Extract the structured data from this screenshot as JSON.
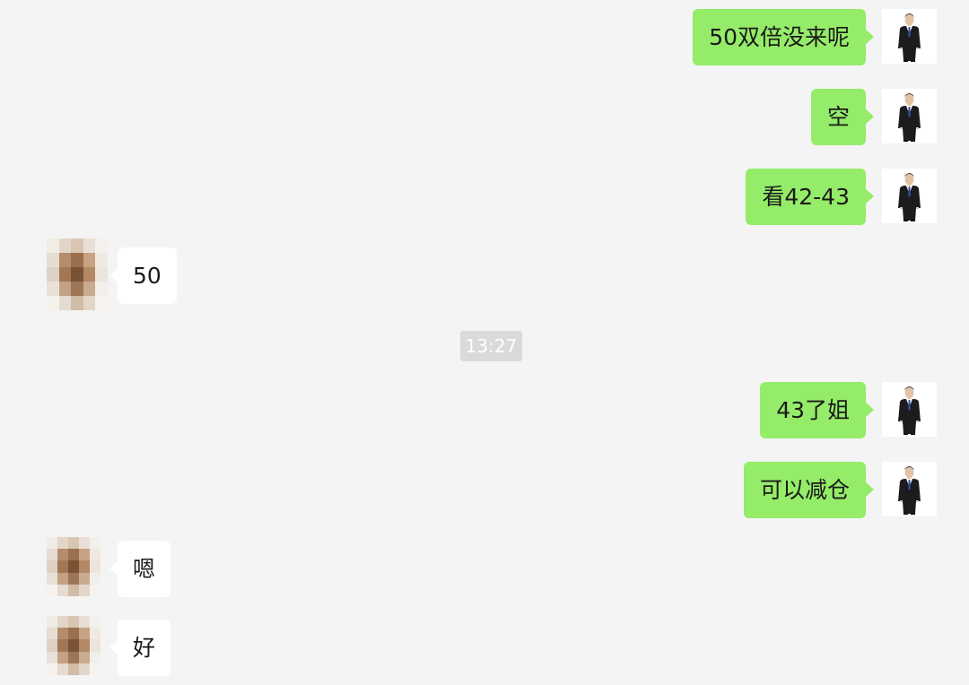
{
  "chat": {
    "messages": [
      {
        "side": "out",
        "text": "50双倍没来呢",
        "avatar": "businessman-avatar"
      },
      {
        "side": "out",
        "text": "空",
        "avatar": "businessman-avatar"
      },
      {
        "side": "out",
        "text": "看42-43",
        "avatar": "businessman-avatar"
      },
      {
        "side": "in",
        "text": "50",
        "avatar": "pixelated-avatar"
      },
      {
        "side": "out",
        "text": "43了姐",
        "avatar": "businessman-avatar"
      },
      {
        "side": "out",
        "text": "可以减仓",
        "avatar": "businessman-avatar"
      },
      {
        "side": "in",
        "text": "嗯",
        "avatar": "pixelated-avatar"
      },
      {
        "side": "in",
        "text": "好",
        "avatar": "pixelated-avatar"
      }
    ],
    "timestamp": "13:27"
  },
  "colors": {
    "background": "#f4f4f4",
    "outgoing_bubble": "#95ec69",
    "incoming_bubble": "#ffffff",
    "timestamp_bg": "#dadada",
    "timestamp_text": "#ffffff"
  }
}
